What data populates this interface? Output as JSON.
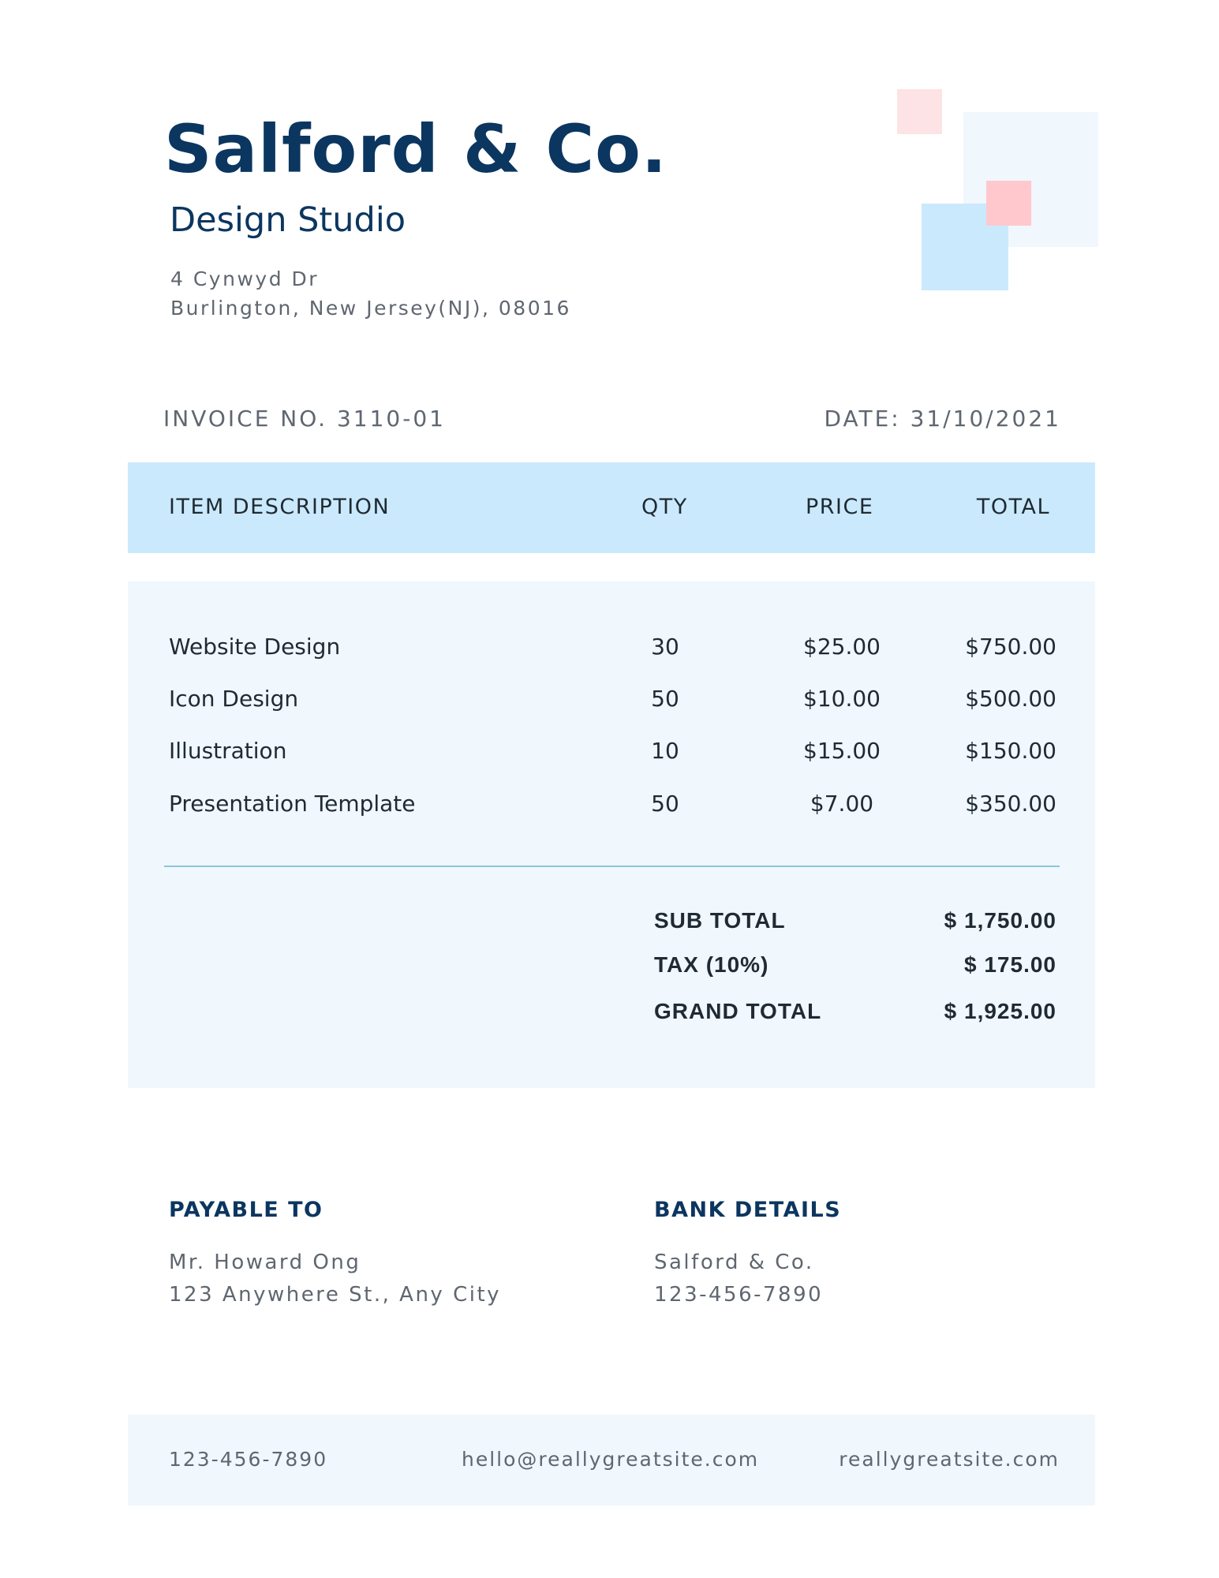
{
  "company": {
    "name": "Salford & Co.",
    "subtitle": "Design Studio",
    "address_line1": "4 Cynwyd Dr",
    "address_line2": "Burlington, New Jersey(NJ), 08016"
  },
  "invoice": {
    "number": "INVOICE NO. 3110-01",
    "date": "DATE: 31/10/2021"
  },
  "table": {
    "headers": {
      "description": "ITEM DESCRIPTION",
      "qty": "QTY",
      "price": "PRICE",
      "total": "TOTAL"
    },
    "rows": [
      {
        "description": "Website Design",
        "qty": "30",
        "price": "$25.00",
        "total": "$750.00"
      },
      {
        "description": "Icon Design",
        "qty": "50",
        "price": "$10.00",
        "total": "$500.00"
      },
      {
        "description": "Illustration",
        "qty": "10",
        "price": "$15.00",
        "total": "$150.00"
      },
      {
        "description": "Presentation Template",
        "qty": "50",
        "price": "$7.00",
        "total": "$350.00"
      }
    ]
  },
  "summary": {
    "subtotal_label": "SUB TOTAL",
    "subtotal_value": "$ 1,750.00",
    "tax_label": "TAX (10%)",
    "tax_value": "$ 175.00",
    "grand_label": "GRAND TOTAL",
    "grand_value": "$ 1,925.00"
  },
  "payable": {
    "title": "PAYABLE TO",
    "name": "Mr. Howard Ong",
    "address": "123 Anywhere St., Any City"
  },
  "bank": {
    "title": "BANK DETAILS",
    "name": "Salford & Co.",
    "account": "123-456-7890"
  },
  "footer": {
    "phone": "123-456-7890",
    "email": "hello@reallygreatsite.com",
    "website": "reallygreatsite.com"
  },
  "colors": {
    "navy": "#0b3660",
    "light_blue": "#cbe9fc",
    "pale_blue": "#f0f7fd",
    "pink": "#fec8cd",
    "light_pink": "#fde3e5"
  }
}
